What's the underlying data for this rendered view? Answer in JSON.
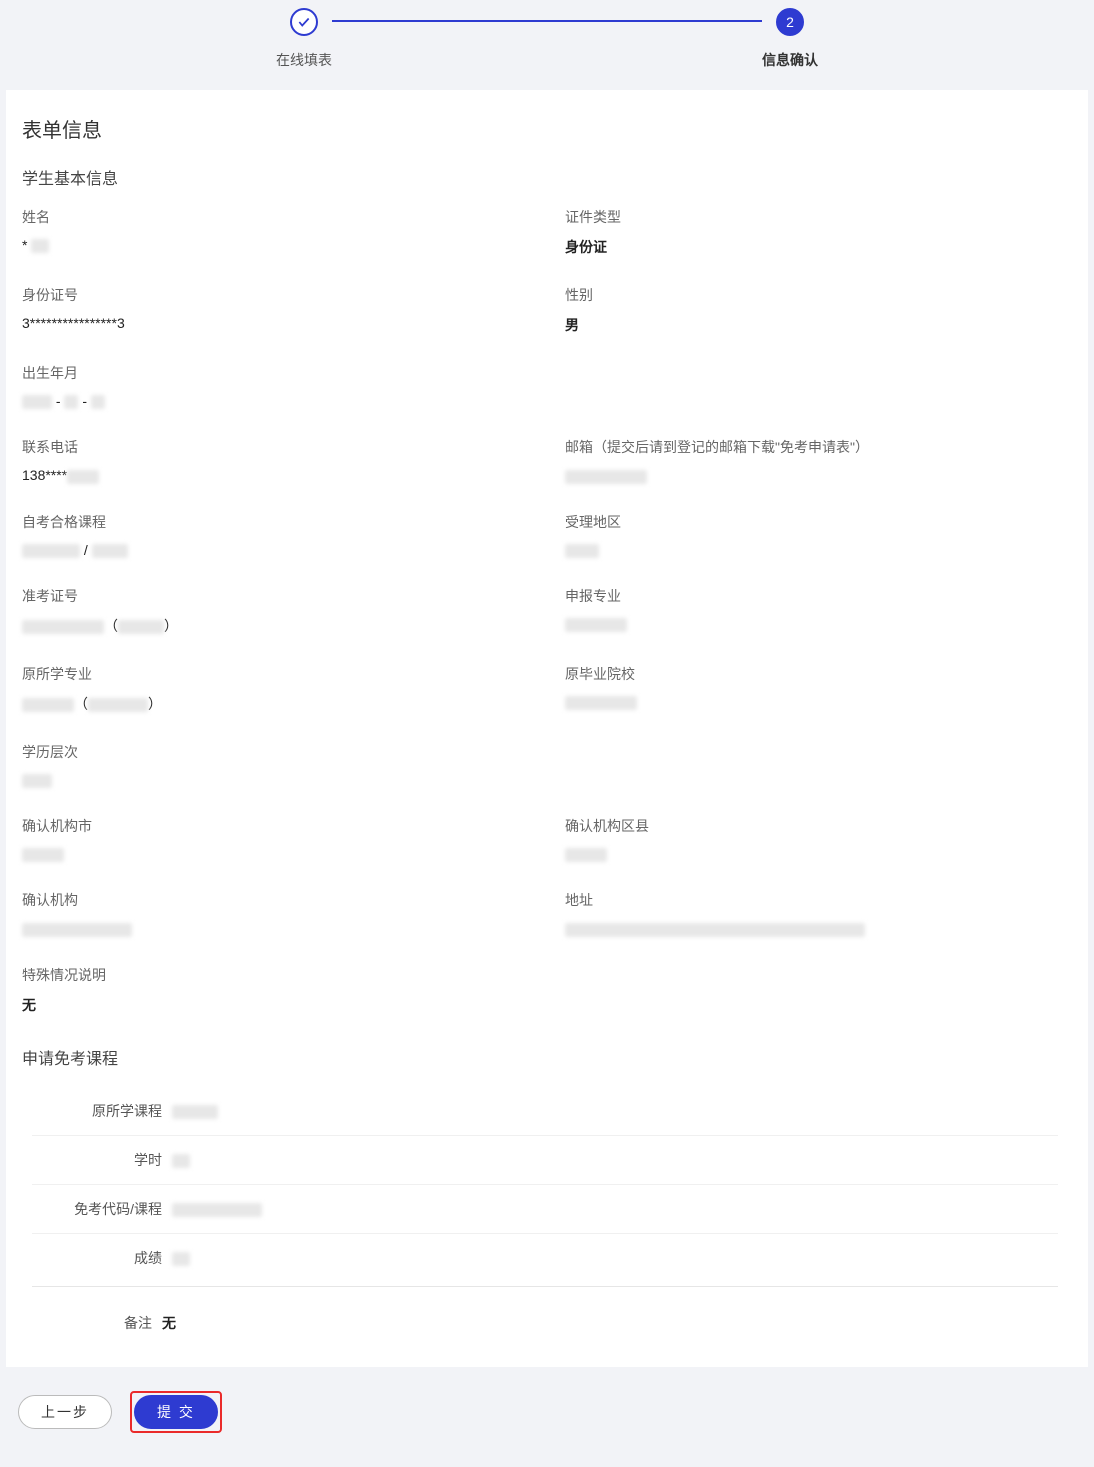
{
  "steps": {
    "step1_label": "在线填表",
    "step2_number": "2",
    "step2_label": "信息确认"
  },
  "titles": {
    "form_info": "表单信息",
    "student_basic": "学生基本信息",
    "exemption_course": "申请免考课程"
  },
  "fields": {
    "name_label": "姓名",
    "name_value": "* ",
    "id_type_label": "证件类型",
    "id_type_value": "身份证",
    "id_number_label": "身份证号",
    "id_number_value": "3****************3",
    "gender_label": "性别",
    "gender_value": "男",
    "birth_label": "出生年月",
    "birth_sep": " - ",
    "phone_label": "联系电话",
    "phone_value": "138****",
    "email_label": "邮箱（提交后请到登记的邮箱下载\"免考申请表\"）",
    "pass_course_label": "自考合格课程",
    "pass_course_sep": " / ",
    "area_label": "受理地区",
    "exam_no_label": "准考证号",
    "exam_no_paren_open": "（",
    "exam_no_paren_close": "）",
    "apply_major_label": "申报专业",
    "orig_major_label": "原所学专业",
    "orig_major_paren_open": "（",
    "orig_major_paren_close": "）",
    "orig_school_label": "原毕业院校",
    "edu_level_label": "学历层次",
    "confirm_city_label": "确认机构市",
    "confirm_county_label": "确认机构区县",
    "confirm_org_label": "确认机构",
    "address_label": "地址",
    "special_label": "特殊情况说明",
    "special_value": "无"
  },
  "course": {
    "orig_course_label": "原所学课程",
    "hours_label": "学时",
    "code_course_label": "免考代码/课程",
    "score_label": "成绩",
    "remark_label": "备注",
    "remark_value": "无"
  },
  "buttons": {
    "prev": "上一步",
    "submit": "提 交"
  }
}
